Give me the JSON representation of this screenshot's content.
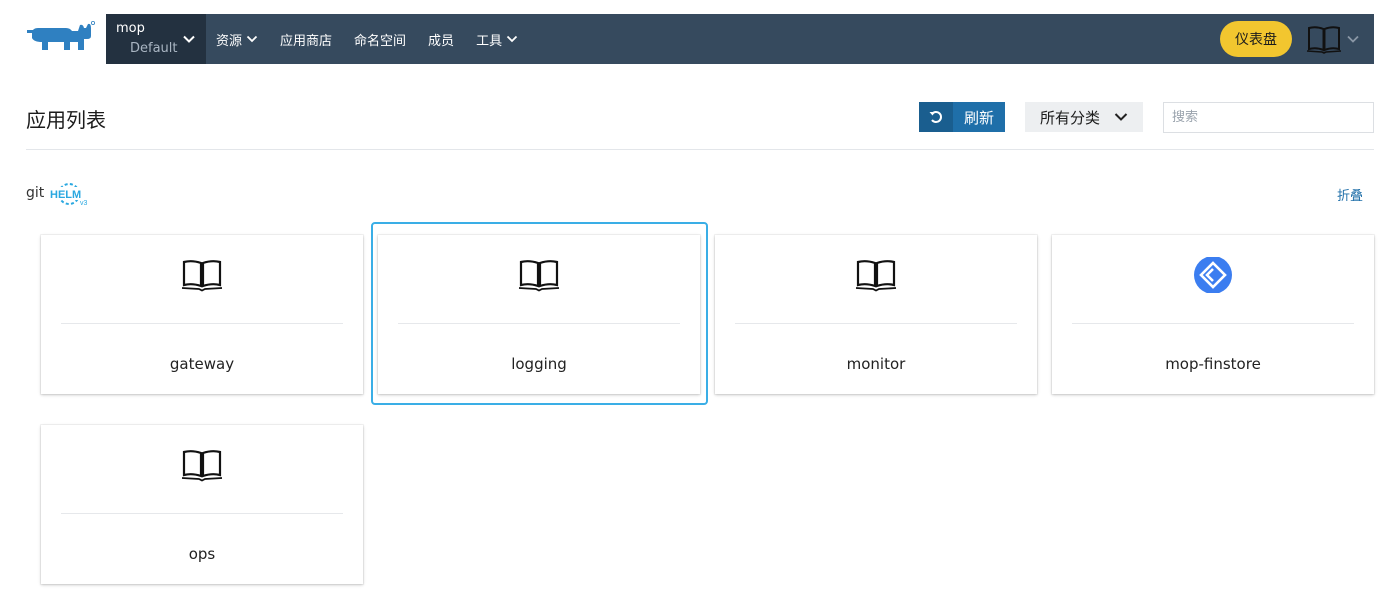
{
  "header": {
    "cluster_name": "mop",
    "project_name": "Default",
    "nav": [
      {
        "label": "资源",
        "has_dropdown": true
      },
      {
        "label": "应用商店",
        "has_dropdown": false
      },
      {
        "label": "命名空间",
        "has_dropdown": false
      },
      {
        "label": "成员",
        "has_dropdown": false
      },
      {
        "label": "工具",
        "has_dropdown": true
      }
    ],
    "dashboard_label": "仪表盘"
  },
  "page": {
    "title": "应用列表",
    "refresh_label": "刷新",
    "category_label": "所有分类",
    "search_placeholder": "搜索"
  },
  "repo": {
    "prefix": "git",
    "helm_text": "HELM",
    "helm_version": "v3",
    "collapse_label": "折叠"
  },
  "apps": [
    {
      "name": "gateway",
      "icon": "book-icon"
    },
    {
      "name": "logging",
      "icon": "book-icon",
      "focused": true
    },
    {
      "name": "monitor",
      "icon": "book-icon"
    },
    {
      "name": "mop-finstore",
      "icon": "blue-diamond-logo-icon"
    },
    {
      "name": "ops",
      "icon": "book-icon"
    }
  ],
  "colors": {
    "navbar": "#364a5e",
    "cluster_bg": "#233140",
    "dashboard_button": "#f2c62f",
    "primary": "#1f6fa9",
    "focus": "#3aaee6"
  }
}
